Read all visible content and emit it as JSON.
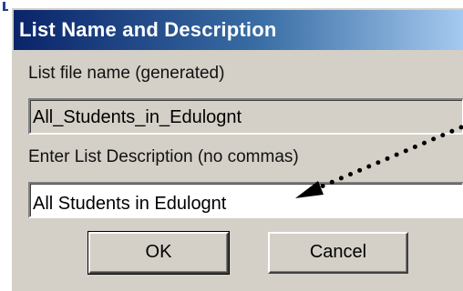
{
  "dialog": {
    "title": "List Name and Description",
    "file_name_label": "List file name (generated)",
    "file_name_value": "All_Students_in_Edulognt",
    "description_label": "Enter List Description (no commas)",
    "description_value": "All Students in Edulognt",
    "ok_label": "OK",
    "cancel_label": "Cancel"
  },
  "colors": {
    "titlebar_start": "#0a246a",
    "titlebar_end": "#a6caf0",
    "dialog_face": "#d4d0c8",
    "annotation_arrow": "#000000"
  },
  "annotation": {
    "icon": "dotted-arrow-icon",
    "points_to": "description-input"
  }
}
